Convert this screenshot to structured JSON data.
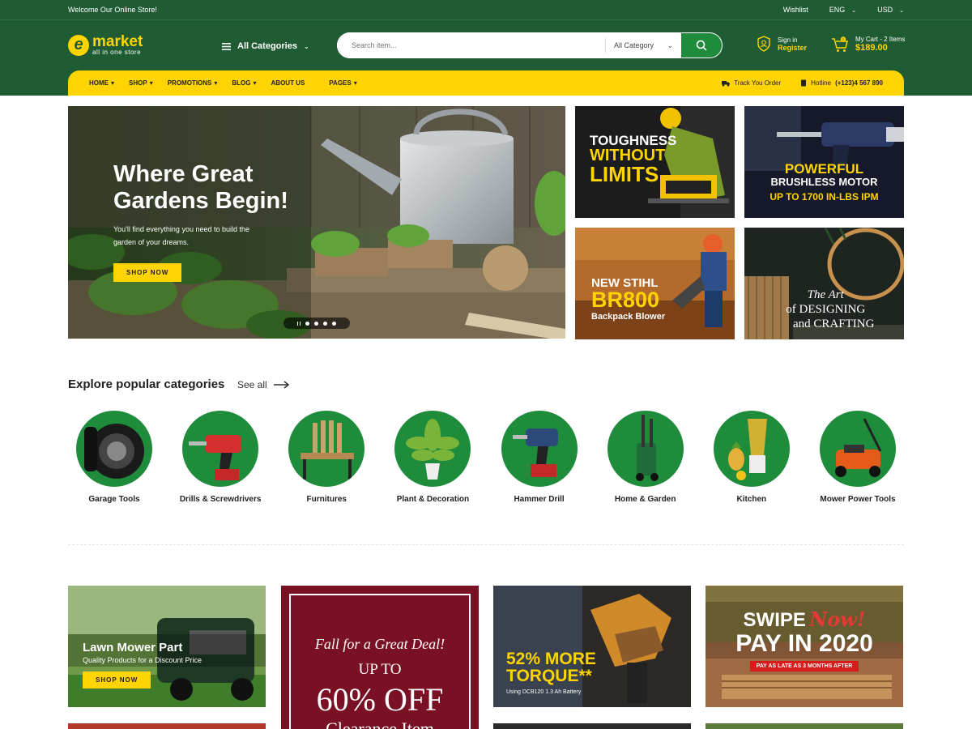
{
  "topbar": {
    "welcome": "Welcome Our Online Store!",
    "wishlist": "Wishlist",
    "lang": "ENG",
    "currency": "USD"
  },
  "logo": {
    "letter": "e",
    "name": "market",
    "tagline": "all in one store"
  },
  "header": {
    "all_categories": "All Categories",
    "search_placeholder": "Search item...",
    "search_category": "All Category",
    "sign_in": "Sign in",
    "register": "Register",
    "cart_label": "My Cart - 2 Items",
    "cart_total": "$189.00"
  },
  "nav": {
    "items": [
      "HOME",
      "SHOP",
      "PROMOTIONS",
      "BLOG",
      "ABOUT US",
      "PAGES"
    ],
    "track": "Track You Order",
    "hotline_label": "Hotline",
    "hotline_number": "(+123)4 567 890"
  },
  "hero": {
    "title_line1": "Where Great",
    "title_line2": "Gardens Begin!",
    "text": "You'll find everything you need to build the garden of your dreams.",
    "button": "SHOP NOW",
    "slide_count": 4
  },
  "promos": [
    {
      "line1": "TOUGHNESS",
      "line2": "WITHOUT",
      "line3": "LIMITS"
    },
    {
      "line1": "POWERFUL",
      "line2": "BRUSHLESS MOTOR",
      "line3": "UP TO 1700 IN-LBS IPM"
    },
    {
      "line1": "NEW STIHL",
      "line2": "BR800",
      "line3": "Backpack Blower"
    },
    {
      "line1": "The Art",
      "line2": "of DESIGNING",
      "line3": "and CRAFTING"
    }
  ],
  "categories": {
    "title": "Explore popular categories",
    "see_all": "See all",
    "items": [
      {
        "name": "Garage Tools",
        "icon": "tires-icon"
      },
      {
        "name": "Drills & Screwdrivers",
        "icon": "drill-icon"
      },
      {
        "name": "Furnitures",
        "icon": "chair-icon"
      },
      {
        "name": "Plant & Decoration",
        "icon": "plant-icon"
      },
      {
        "name": "Hammer Drill",
        "icon": "hammer-drill-icon"
      },
      {
        "name": "Home & Garden",
        "icon": "pressure-washer-icon"
      },
      {
        "name": "Kitchen",
        "icon": "blender-icon"
      },
      {
        "name": "Mower Power Tools",
        "icon": "lawn-mower-icon"
      }
    ]
  },
  "banners": [
    {
      "title": "Lawn Mower Part",
      "subtitle": "Quality Products for a Discount Price",
      "button": "SHOP NOW"
    },
    {
      "line1": "Fall for a Great Deal!",
      "line2": "UP TO",
      "line3": "60% OFF",
      "line4": "Clearance Item"
    },
    {
      "line1": "52% MORE",
      "line2": "TORQUE**",
      "line3": "Using DCB120 1.3 Ah Battery"
    },
    {
      "line1": "SWIPE",
      "line2": "Now!",
      "line3": "PAY IN 2020",
      "line4": "PAY AS LATE AS 3 MONTHS AFTER"
    }
  ],
  "colors": {
    "brand_green": "#1f5c33",
    "accent_yellow": "#ffd400",
    "button_green": "#1f8c3c",
    "banner_red": "#7a1023"
  }
}
